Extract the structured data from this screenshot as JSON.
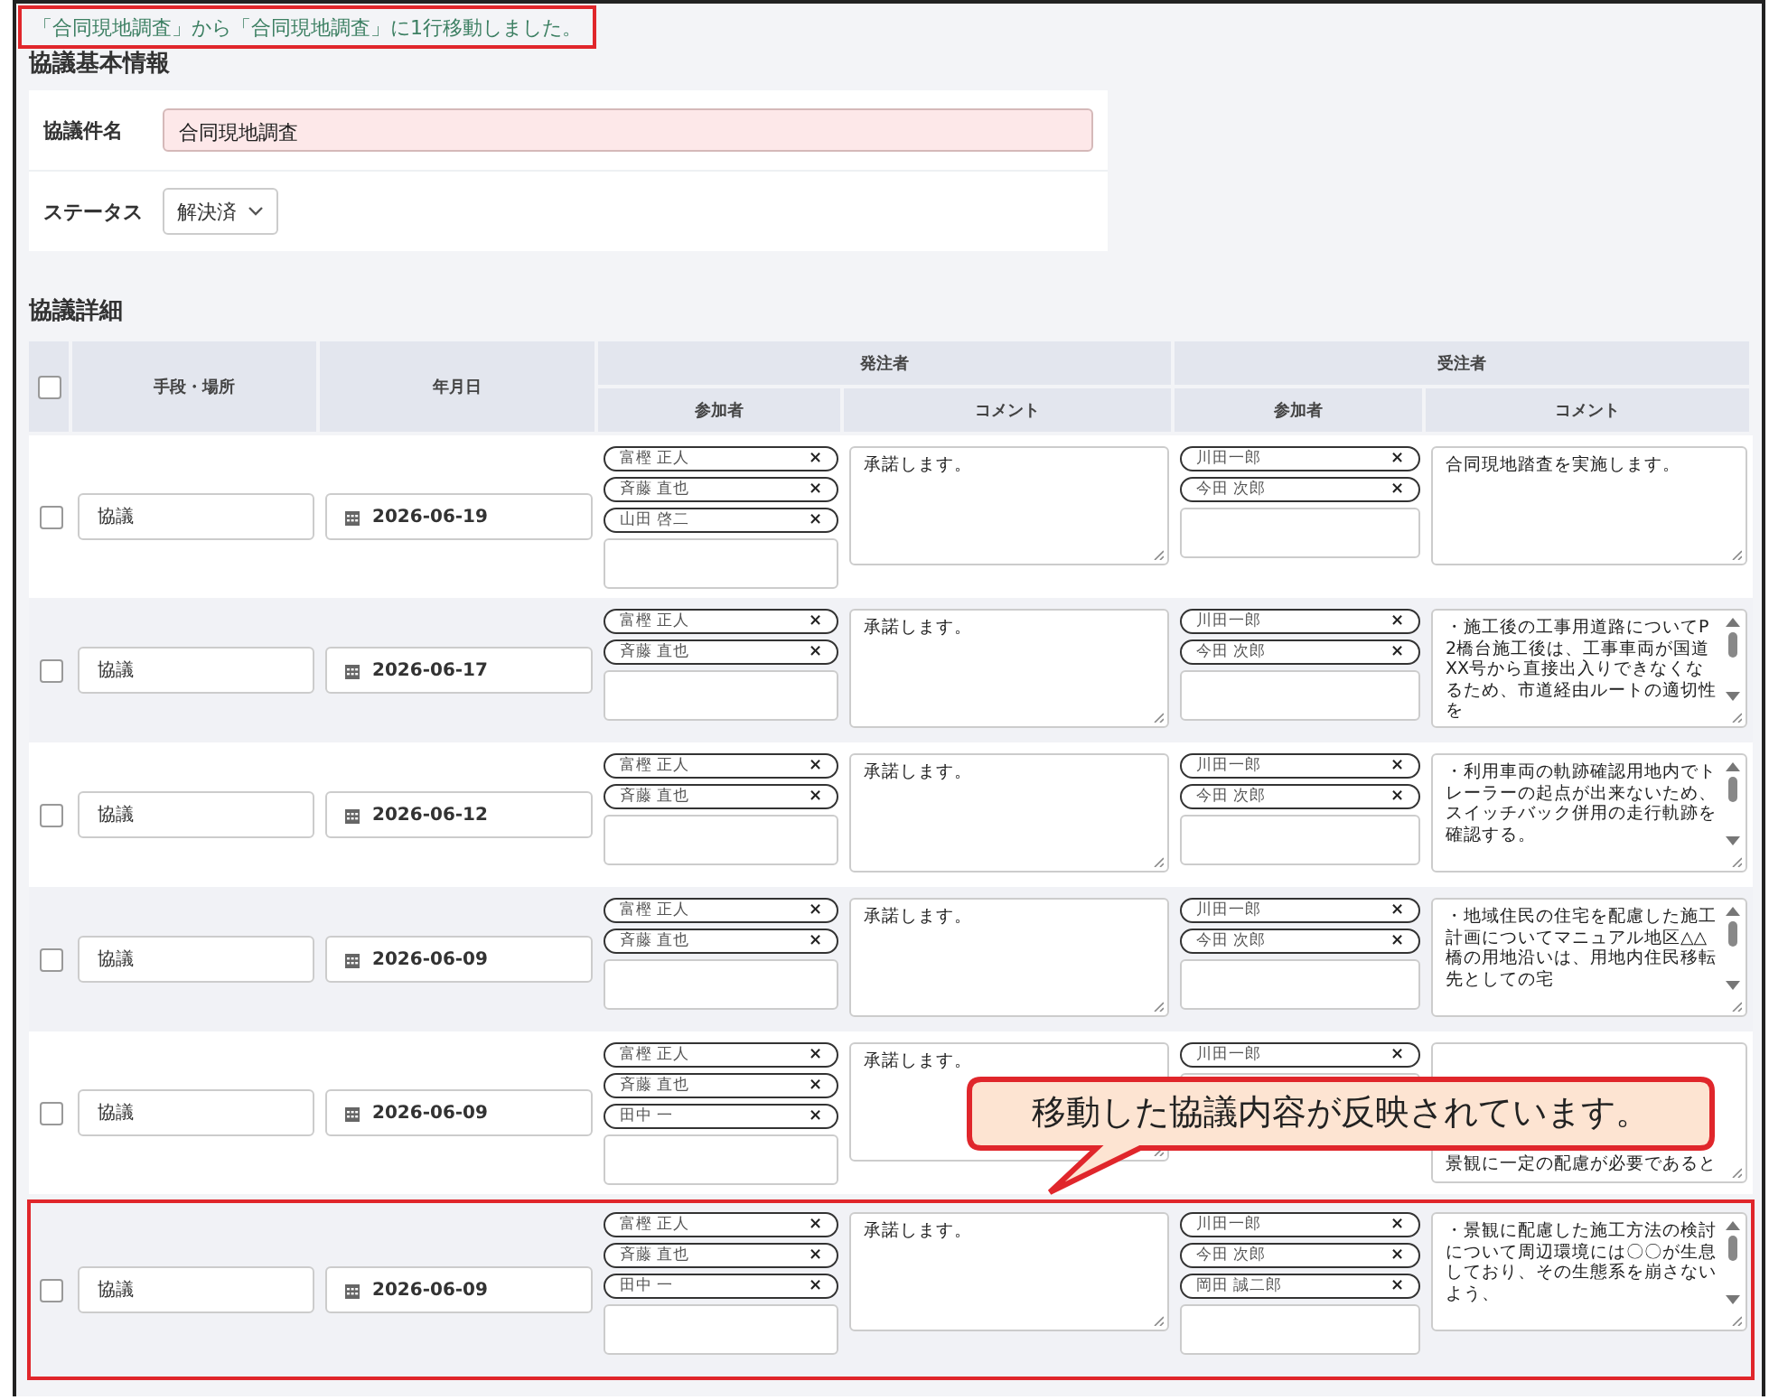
{
  "notice": "「合同現地調査」から「合同現地調査」に1行移動しました。",
  "basic_info": {
    "title": "協議基本情報",
    "fields": [
      {
        "kind": "text",
        "label": "協議件名",
        "value": "合同現地調査"
      },
      {
        "kind": "select",
        "label": "ステータス",
        "value": "解決済"
      }
    ]
  },
  "details": {
    "title": "協議詳細",
    "select_all_checked": false,
    "remove_glyph": "×",
    "headers": {
      "method": "手段・場所",
      "date": "年月日",
      "groups": [
        {
          "label": "発注者",
          "columns": [
            "参加者",
            "コメント"
          ]
        },
        {
          "label": "受注者",
          "columns": [
            "参加者",
            "コメント"
          ]
        }
      ]
    },
    "rows": [
      {
        "checked": false,
        "highlighted": false,
        "method": "協議",
        "date": "2026-06-19",
        "orderer": {
          "participants": [
            "富樫 正人",
            "斉藤 直也",
            "山田 啓二"
          ],
          "comment": "承諾します。"
        },
        "contractor": {
          "participants": [
            "川田一郎",
            "今田 次郎"
          ],
          "comment": "合同現地踏査を実施します。"
        }
      },
      {
        "checked": false,
        "highlighted": false,
        "method": "協議",
        "date": "2026-06-17",
        "orderer": {
          "participants": [
            "富樫 正人",
            "斉藤 直也"
          ],
          "comment": "承諾します。"
        },
        "contractor": {
          "participants": [
            "川田一郎",
            "今田 次郎"
          ],
          "comment": "・施工後の工事用道路についてP2橋台施工後は、工事車両が国道XX号から直接出入りできなくなるため、市道経由ルートの適切性を"
        }
      },
      {
        "checked": false,
        "highlighted": false,
        "method": "協議",
        "date": "2026-06-12",
        "orderer": {
          "participants": [
            "富樫 正人",
            "斉藤 直也"
          ],
          "comment": "承諾します。"
        },
        "contractor": {
          "participants": [
            "川田一郎",
            "今田 次郎"
          ],
          "comment": "・利用車両の軌跡確認用地内でトレーラーの起点が出来ないため、スイッチバック併用の走行軌跡を確認する。"
        }
      },
      {
        "checked": false,
        "highlighted": false,
        "method": "協議",
        "date": "2026-06-09",
        "orderer": {
          "participants": [
            "富樫 正人",
            "斉藤 直也"
          ],
          "comment": "承諾します。"
        },
        "contractor": {
          "participants": [
            "川田一郎",
            "今田 次郎"
          ],
          "comment": "・地域住民の住宅を配慮した施工計画についてマニュアル地区△△橋の用地沿いは、用地内住民移転先としての宅"
        }
      },
      {
        "checked": false,
        "highlighted": false,
        "method": "協議",
        "date": "2026-06-09",
        "orderer": {
          "participants": [
            "富樫 正人",
            "斉藤 直也",
            "田中 一"
          ],
          "comment": "承諾します。"
        },
        "contractor": {
          "participants": [
            "川田一郎"
          ],
          "comment": "景観に一定の配慮が必要であると"
        }
      },
      {
        "checked": false,
        "highlighted": true,
        "method": "協議",
        "date": "2026-06-09",
        "orderer": {
          "participants": [
            "富樫 正人",
            "斉藤 直也",
            "田中 一"
          ],
          "comment": "承諾します。"
        },
        "contractor": {
          "participants": [
            "川田一郎",
            "今田 次郎",
            "岡田 誠二郎"
          ],
          "comment": "・景観に配慮した施工方法の検討について周辺環境には〇〇が生息しており、その生態系を崩さないよう、"
        }
      }
    ]
  },
  "callout": {
    "text": "移動した協議内容が反映されています。"
  }
}
